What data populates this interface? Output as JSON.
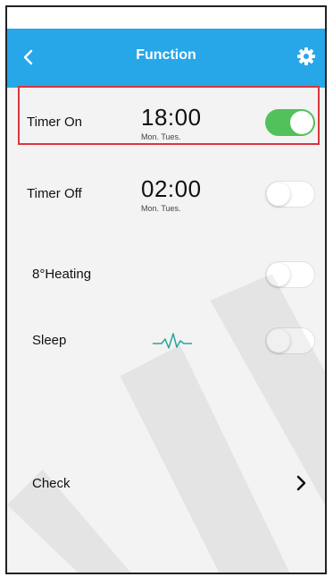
{
  "header": {
    "title": "Function",
    "back_icon": "chevron-left-icon",
    "settings_icon": "gear-icon"
  },
  "colors": {
    "header_bg": "#27a7e8",
    "toggle_on": "#52c15b",
    "highlight": "#d9353a"
  },
  "rows": [
    {
      "label": "Timer On",
      "time": "18:00",
      "days": "Mon. Tues.",
      "toggle": true
    },
    {
      "label": "Timer Off",
      "time": "02:00",
      "days": "Mon. Tues.",
      "toggle": false
    },
    {
      "label": "8°Heating",
      "toggle": false
    },
    {
      "label": "Sleep",
      "icon": "heartbeat-icon",
      "toggle": false
    }
  ],
  "check": {
    "label": "Check",
    "icon": "chevron-right-icon"
  }
}
